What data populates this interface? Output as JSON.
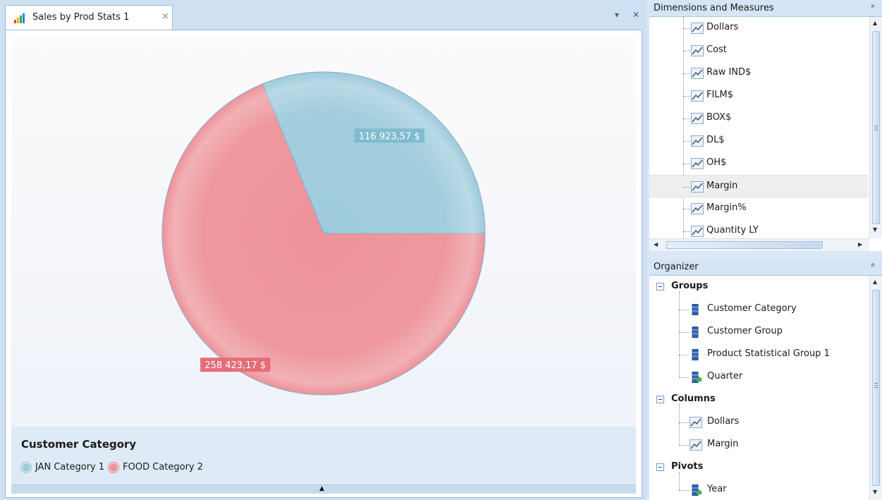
{
  "document": {
    "tab_title": "Sales by Prod Stats 1",
    "tab_close": "×",
    "dropdown_glyph": "▾",
    "close_glyph": "✕"
  },
  "chart_data": {
    "type": "pie",
    "labels": [
      "JAN Category 1",
      "FOOD Category 2"
    ],
    "values": [
      116923.57,
      258423.17
    ],
    "data_labels": [
      "116 923,57 $",
      "258 423,17 $"
    ],
    "colors": [
      "#9ecbdc",
      "#ed9399"
    ],
    "legend_title": "Customer Category",
    "legend_position": "bottom"
  },
  "dimensions_panel": {
    "title": "Dimensions and Measures",
    "pin": "ᵖ",
    "items": [
      {
        "label": "Dollars"
      },
      {
        "label": "Cost"
      },
      {
        "label": "Raw IND$"
      },
      {
        "label": "FILM$"
      },
      {
        "label": "BOX$"
      },
      {
        "label": "DL$"
      },
      {
        "label": "OH$"
      },
      {
        "label": "Margin",
        "selected": true
      },
      {
        "label": "Margin%"
      },
      {
        "label": "Quantity LY"
      }
    ]
  },
  "organizer_panel": {
    "title": "Organizer",
    "pin": "ᵖ",
    "groups": [
      {
        "label": "Groups",
        "items": [
          {
            "label": "Customer Category",
            "icon": "dimension-icon"
          },
          {
            "label": "Customer Group",
            "icon": "dimension-icon"
          },
          {
            "label": "Product Statistical Group 1",
            "icon": "dimension-icon"
          },
          {
            "label": "Quarter",
            "icon": "time-dimension-icon"
          }
        ]
      },
      {
        "label": "Columns",
        "items": [
          {
            "label": "Dollars",
            "icon": "measure-icon"
          },
          {
            "label": "Margin",
            "icon": "measure-icon"
          }
        ]
      },
      {
        "label": "Pivots",
        "items": [
          {
            "label": "Year",
            "icon": "time-dimension-icon"
          }
        ]
      }
    ]
  }
}
